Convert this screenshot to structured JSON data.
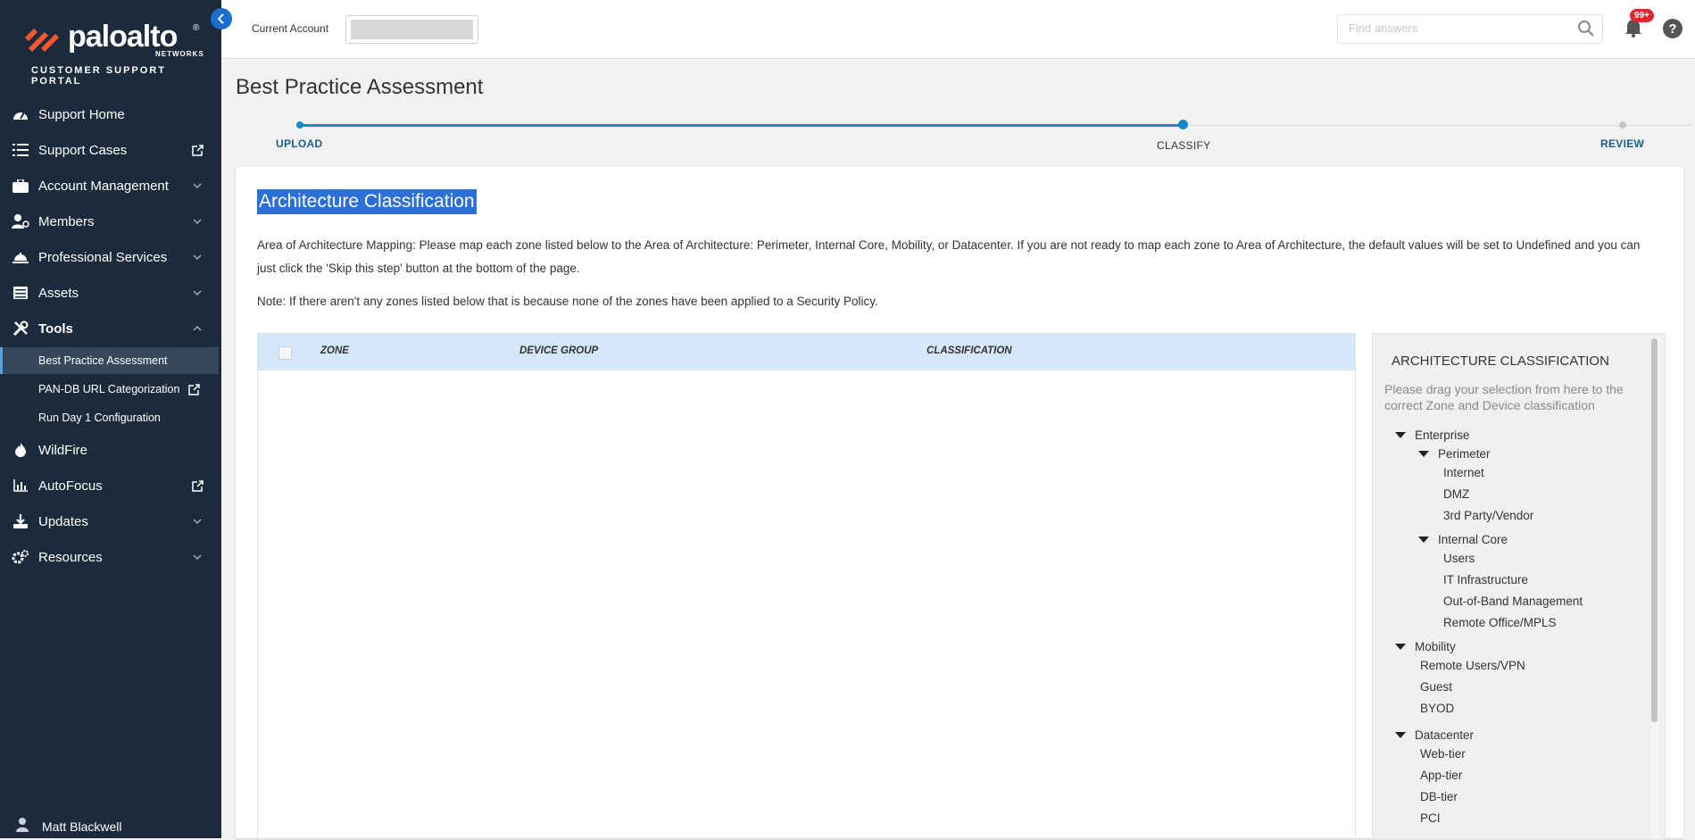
{
  "brand": {
    "wordmark": "paloalto",
    "reg": "®",
    "networks": "NETWORKS",
    "portal": "CUSTOMER SUPPORT PORTAL"
  },
  "sidebar": {
    "items": [
      {
        "label": "Support Home",
        "icon": "dashboard-icon",
        "trail": ""
      },
      {
        "label": "Support Cases",
        "icon": "list-icon",
        "trail": "external-link-icon"
      },
      {
        "label": "Account Management",
        "icon": "briefcase-icon",
        "trail": "chevron-down-icon"
      },
      {
        "label": "Members",
        "icon": "members-icon",
        "trail": "chevron-down-icon"
      },
      {
        "label": "Professional Services",
        "icon": "bell-services-icon",
        "trail": "chevron-down-icon"
      },
      {
        "label": "Assets",
        "icon": "table-icon",
        "trail": "chevron-down-icon"
      },
      {
        "label": "Tools",
        "icon": "tools-icon",
        "trail": "chevron-up-icon"
      },
      {
        "label": "WildFire",
        "icon": "flame-icon",
        "trail": ""
      },
      {
        "label": "AutoFocus",
        "icon": "bar-chart-icon",
        "trail": "external-link-icon"
      },
      {
        "label": "Updates",
        "icon": "download-icon",
        "trail": "chevron-down-icon"
      },
      {
        "label": "Resources",
        "icon": "gears-icon",
        "trail": "chevron-down-icon"
      }
    ],
    "tools_sub": [
      {
        "label": "Best Practice Assessment",
        "active": true
      },
      {
        "label": "PAN-DB URL Categorization",
        "trail": "external-link-icon"
      },
      {
        "label": "Run Day 1 Configuration"
      }
    ],
    "user": "Matt Blackwell"
  },
  "header": {
    "account_label": "Current Account",
    "search_placeholder": "Find answers",
    "notifications": "99+"
  },
  "page": {
    "title": "Best Practice Assessment"
  },
  "stepper": {
    "steps": [
      "UPLOAD",
      "CLASSIFY",
      "REVIEW"
    ],
    "current": "CLASSIFY"
  },
  "card": {
    "title": "Architecture Classification",
    "description": "Area of Architecture Mapping: Please map each zone listed below to the Area of Architecture: Perimeter, Internal Core, Mobility, or Datacenter. If you are not ready to map each zone to Area of Architecture, the default values will be set to Undefined and you can just click the 'Skip this step' button at the bottom of the page.",
    "note": "Note: If there aren't any zones listed below that is because none of the zones have been applied to a Security Policy."
  },
  "table": {
    "columns": [
      "ZONE",
      "DEVICE GROUP",
      "CLASSIFICATION"
    ],
    "rows": []
  },
  "panel": {
    "title": "ARCHITECTURE CLASSIFICATION",
    "hint": "Please drag your selection from here to the correct Zone and Device classification",
    "tree": {
      "enterprise": "Enterprise",
      "perimeter": "Perimeter",
      "perimeter_items": [
        "Internet",
        "DMZ",
        "3rd Party/Vendor"
      ],
      "internal_core": "Internal Core",
      "internal_items": [
        "Users",
        "IT Infrastructure",
        "Out-of-Band Management",
        "Remote Office/MPLS"
      ],
      "mobility": "Mobility",
      "mobility_items": [
        "Remote Users/VPN",
        "Guest",
        "BYOD"
      ],
      "datacenter": "Datacenter",
      "datacenter_items": [
        "Web-tier",
        "App-tier",
        "DB-tier",
        "PCI"
      ]
    }
  },
  "colors": {
    "sidebar_bg": "#1c2b3c",
    "accent": "#1a8ac6",
    "selection": "#2c6fd6",
    "table_header": "#d4e8f9",
    "badge": "#e3262e"
  }
}
